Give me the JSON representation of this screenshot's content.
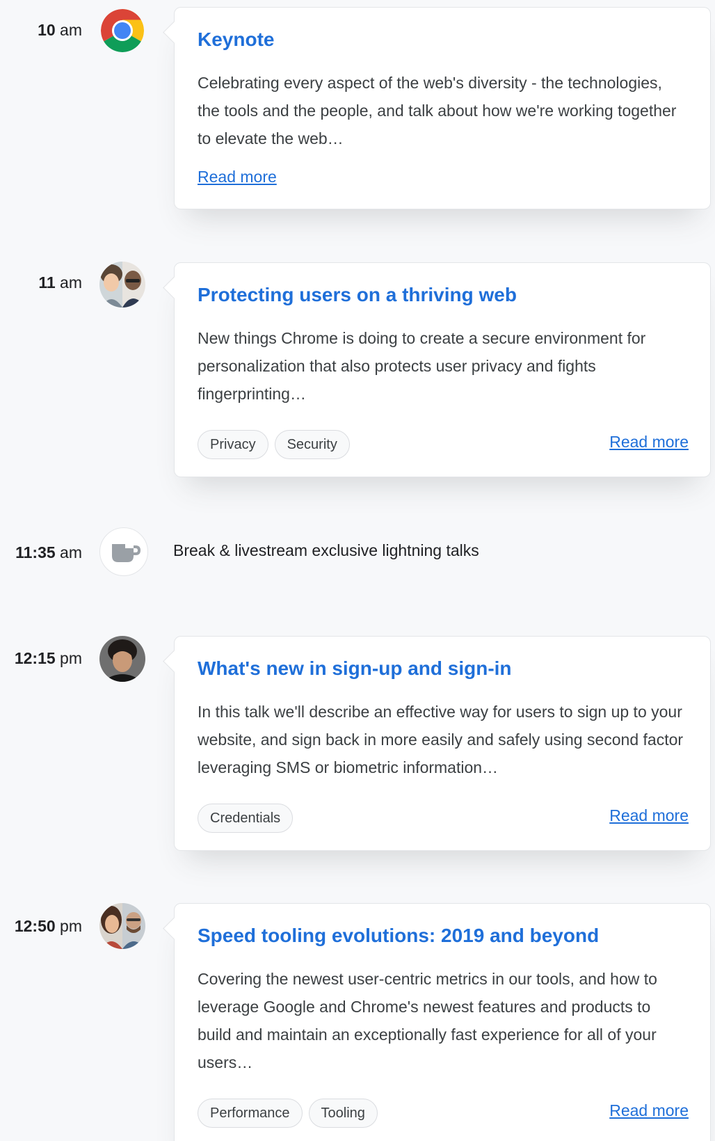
{
  "schedule": [
    {
      "time_number": "10",
      "time_suffix": "am",
      "avatar_icon": "chrome-logo-icon",
      "title": "Keynote",
      "description": "Celebrating every aspect of the web's diversity - the technologies, the tools and the people, and talk about how we're working together to elevate the web…",
      "tags": [],
      "read_more": "Read more"
    },
    {
      "time_number": "11",
      "time_suffix": "am",
      "avatar_icon": "two-speakers-avatar",
      "title": "Protecting users on a thriving web",
      "description": "New things Chrome is doing to create a secure environment for personalization that also protects user privacy and fights fingerprinting…",
      "tags": [
        "Privacy",
        "Security"
      ],
      "read_more": "Read more"
    },
    {
      "time_number": "11:35",
      "time_suffix": "am",
      "avatar_icon": "coffee-cup-icon",
      "break_text": "Break & livestream exclusive lightning talks"
    },
    {
      "time_number": "12:15",
      "time_suffix": "pm",
      "avatar_icon": "speaker-avatar",
      "title": "What's new in sign-up and sign-in",
      "description": "In this talk we'll describe an effective way for users to sign up to your website, and sign back in more easily and safely using second factor leveraging SMS or biometric information…",
      "tags": [
        "Credentials"
      ],
      "read_more": "Read more"
    },
    {
      "time_number": "12:50",
      "time_suffix": "pm",
      "avatar_icon": "two-speakers-avatar",
      "title": "Speed tooling evolutions: 2019 and beyond",
      "description": "Covering the newest user-centric metrics in our tools, and how to leverage Google and Chrome's newest features and products to build and maintain an exceptionally fast experience for all of your users…",
      "tags": [
        "Performance",
        "Tooling"
      ],
      "read_more": "Read more"
    }
  ]
}
